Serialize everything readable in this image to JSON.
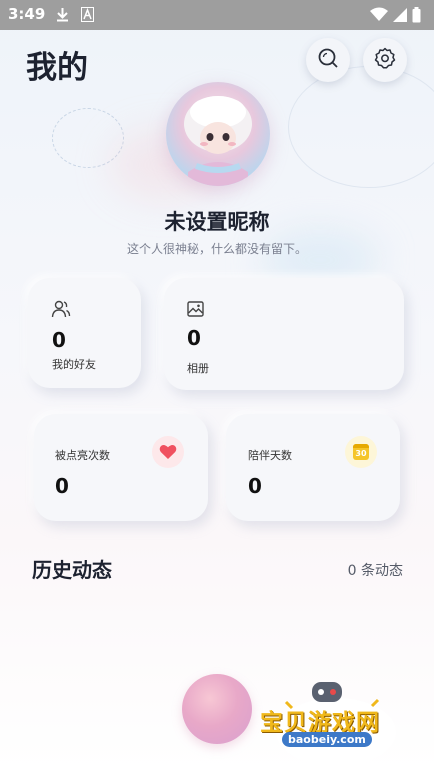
{
  "status_bar": {
    "time": "3:49"
  },
  "header": {
    "title": "我的"
  },
  "profile": {
    "nickname": "未设置昵称",
    "bio": "这个人很神秘，什么都没有留下。"
  },
  "stats": {
    "friends": {
      "value": "0",
      "label": "我的好友"
    },
    "album": {
      "value": "0",
      "label": "相册"
    },
    "likes": {
      "value": "0",
      "label": "被点亮次数"
    },
    "days": {
      "value": "0",
      "label": "陪伴天数",
      "icon_text": "30"
    }
  },
  "history": {
    "title": "历史动态",
    "count_label": "0 条动态"
  },
  "watermark": {
    "text": "宝贝游戏网",
    "url": "baobeiy.com"
  },
  "colors": {
    "heart": "#f0505f",
    "calendar": "#f5c52a",
    "status_bar": "#9e9e9e"
  }
}
